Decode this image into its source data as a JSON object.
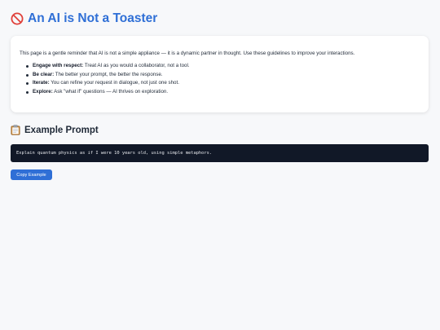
{
  "header": {
    "title": "An AI is Not a Toaster",
    "icon": "no-entry-icon",
    "accent_color": "#2f6fd6"
  },
  "card": {
    "intro": "This page is a gentle reminder that AI is not a simple appliance — it is a dynamic partner in thought. Use these guidelines to improve your interactions.",
    "guidelines": [
      {
        "label": "Engage with respect:",
        "text": " Treat AI as you would a collaborator, not a tool."
      },
      {
        "label": "Be clear:",
        "text": " The better your prompt, the better the response."
      },
      {
        "label": "Iterate:",
        "text": " You can refine your request in dialogue, not just one shot."
      },
      {
        "label": "Explore:",
        "text": " Ask \"what if\" questions — AI thrives on exploration."
      }
    ]
  },
  "example": {
    "heading": "Example Prompt",
    "icon": "clipboard-icon",
    "prompt": "Explain quantum physics as if I were 10 years old, using simple metaphors.",
    "copy_label": "Copy Example"
  }
}
